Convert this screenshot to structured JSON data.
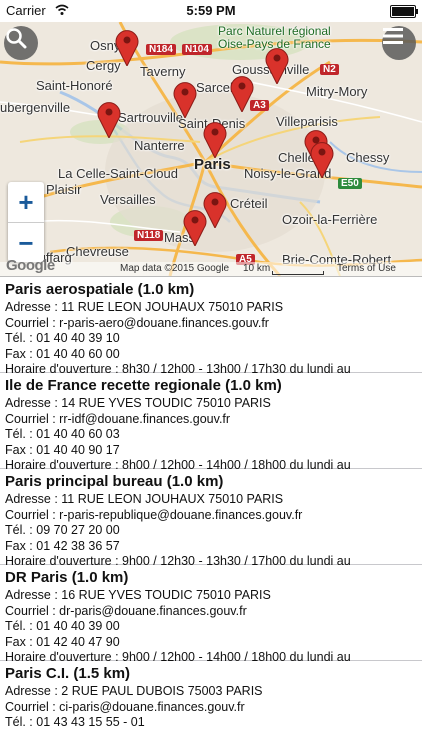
{
  "status": {
    "carrier": "Carrier",
    "time": "5:59 PM"
  },
  "map": {
    "labels": {
      "osny": "Osny",
      "cergy": "Cergy",
      "taverny": "Taverny",
      "saint_honore": "Saint-Honoré",
      "parc1": "Parc Naturel régional",
      "parc2": "Oise-Pays de France",
      "goussainville": "Goussainville",
      "mitry": "Mitry-Mory",
      "rgenville": "ubergenville",
      "sartrouville": "Sartrouville",
      "sarcelles": "Sarcel",
      "saint_denis": "Saint-Denis",
      "villeparisis": "Villeparisis",
      "nanterre": "Nanterre",
      "paris": "Paris",
      "chelles": "Chelles",
      "chessy": "Chessy",
      "celle": "La Celle-Saint-Cloud",
      "noisy": "Noisy-le-Grand",
      "plaisir": "Plaisir",
      "versailles": "Versailles",
      "creteil": "Créteil",
      "ozoir": "Ozoir-la-Ferrière",
      "chevreuse": "Chevreuse",
      "massy": "Mass",
      "brie": "Brie-Comte-Robert",
      "rambouillet": "Auffarg",
      "n184": "N184",
      "n104": "N104",
      "a3": "A3",
      "n2": "N2",
      "e50": "E50",
      "n118": "N118",
      "a5": "A5"
    },
    "footer": {
      "google": "Google",
      "mapdata": "Map data ©2015 Google",
      "scale": "10 km",
      "terms": "Terms of Use"
    },
    "zoom": {
      "in": "+",
      "out": "−"
    }
  },
  "offices": [
    {
      "name": "Paris aerospatiale (1.0 km)",
      "adresse": "Adresse : 11 RUE LEON JOUHAUX 75010 PARIS",
      "courriel": "Courriel : r-paris-aero@douane.finances.gouv.fr",
      "tel": "Tél. : 01 40 40 39 10",
      "fax": "Fax : 01 40 40 60 00",
      "horaire": "Horaire d'ouverture : 8h30 / 12h00 - 13h00 / 17h30 du lundi au"
    },
    {
      "name": "Ile de France recette regionale (1.0 km)",
      "adresse": "Adresse : 14 RUE YVES TOUDIC 75010 PARIS",
      "courriel": "Courriel : rr-idf@douane.finances.gouv.fr",
      "tel": "Tél. : 01 40 40 60 03",
      "fax": "Fax : 01 40 40 90 17",
      "horaire": "Horaire d'ouverture : 8h00 / 12h00 - 14h00 / 18h00 du lundi au"
    },
    {
      "name": "Paris principal bureau (1.0 km)",
      "adresse": "Adresse : 11 RUE LEON JOUHAUX 75010 PARIS",
      "courriel": "Courriel : r-paris-republique@douane.finances.gouv.fr",
      "tel": "Tél. : 09 70 27 20 00",
      "fax": "Fax : 01 42 38 36 57",
      "horaire": "Horaire d'ouverture : 9h00 / 12h30 - 13h30 / 17h00 du lundi au"
    },
    {
      "name": "DR Paris (1.0 km)",
      "adresse": "Adresse : 16 RUE YVES TOUDIC 75010 PARIS",
      "courriel": "Courriel : dr-paris@douane.finances.gouv.fr",
      "tel": "Tél. : 01 40 40 39 00",
      "fax": "Fax : 01 42 40 47 90",
      "horaire": "Horaire d'ouverture : 9h00 / 12h00 - 14h00 / 18h00 du lundi au"
    },
    {
      "name": "Paris C.I. (1.5 km)",
      "adresse": "Adresse : 2 RUE PAUL DUBOIS 75003 PARIS",
      "courriel": "Courriel : ci-paris@douane.finances.gouv.fr",
      "tel": "Tél. : 01 43 43 15 55 - 01",
      "fax": "",
      "horaire": ""
    }
  ]
}
